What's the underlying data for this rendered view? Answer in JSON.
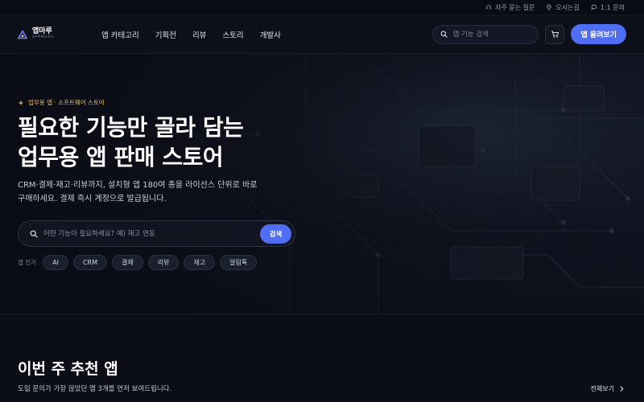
{
  "utility": {
    "faq": "자주 묻는 질문",
    "directions": "오시는길",
    "inquiry": "1:1 문의"
  },
  "brand": {
    "name": "앱마루",
    "subtitle": "APPMARU"
  },
  "nav": {
    "items": [
      {
        "label": "앱 카테고리"
      },
      {
        "label": "기획전"
      },
      {
        "label": "리뷰"
      },
      {
        "label": "스토리"
      },
      {
        "label": "개발사"
      }
    ],
    "search_placeholder": "앱·기능 검색",
    "sell_label": "앱 올려보기"
  },
  "hero": {
    "eyebrow": "업무용 앱 · 소프트웨어 스토어",
    "title_line1": "필요한 기능만 골라 담는",
    "title_line2": "업무용 앱 판매 스토어",
    "desc_line1": "CRM·결제·재고·리뷰까지, 설치형 앱 180여 종을 라이선스 단위로 바로",
    "desc_line2": "구매하세요. 결제 즉시 계정으로 발급됩니다.",
    "search_placeholder": "어떤 기능이 필요하세요? 예) 재고 연동",
    "search_button": "검색",
    "popular_label": "앱 인기",
    "tags": [
      {
        "label": "AI"
      },
      {
        "label": "CRM"
      },
      {
        "label": "결제"
      },
      {
        "label": "리뷰"
      },
      {
        "label": "재고"
      },
      {
        "label": "알림톡"
      }
    ]
  },
  "section": {
    "title": "이번 주 추천 앱",
    "subtitle": "도입 문의가 가장 많았던 앱 3개를 먼저 보여드립니다.",
    "view_all": "전체보기"
  },
  "colors": {
    "accent": "#4f6df5",
    "eyebrow": "#e7b96a",
    "background": "#0b0e16"
  },
  "icons": {
    "faq": "headset-icon",
    "directions": "map-pin-icon",
    "inquiry": "chat-bubble-icon",
    "logo": "triangle-logo-icon",
    "search": "search-icon",
    "cart": "cart-icon",
    "eyebrow": "sparkle-icon",
    "view_all": "chevron-right-icon"
  }
}
